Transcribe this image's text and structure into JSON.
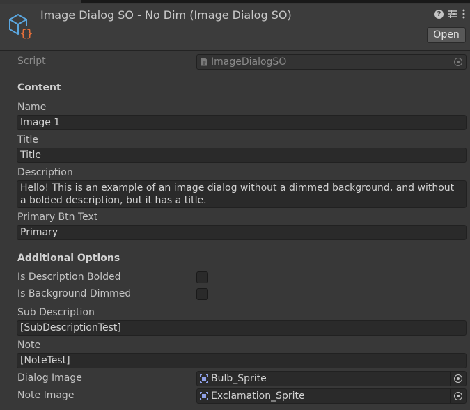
{
  "header": {
    "title": "Image Dialog SO - No Dim (Image Dialog SO)",
    "open_label": "Open",
    "icons": [
      "help-icon",
      "preset-sliders-icon",
      "more-vert-icon"
    ]
  },
  "script_row": {
    "label": "Script",
    "value": "ImageDialogSO"
  },
  "content": {
    "section_label": "Content",
    "name": {
      "label": "Name",
      "value": "Image 1"
    },
    "title": {
      "label": "Title",
      "value": "Title"
    },
    "description": {
      "label": "Description",
      "value": "Hello! This is an example of an image dialog without a dimmed background, and without a bolded description, but it has a title."
    },
    "primary_btn_text": {
      "label": "Primary Btn Text",
      "value": "Primary"
    }
  },
  "additional": {
    "section_label": "Additional Options",
    "is_description_bolded": {
      "label": "Is Description Bolded",
      "checked": false
    },
    "is_background_dimmed": {
      "label": "Is Background Dimmed",
      "checked": false
    },
    "sub_description": {
      "label": "Sub Description",
      "value": "[SubDescriptionTest]"
    },
    "note": {
      "label": "Note",
      "value": "[NoteTest]"
    },
    "dialog_image": {
      "label": "Dialog Image",
      "value": "Bulb_Sprite"
    },
    "note_image": {
      "label": "Note Image",
      "value": "Exclamation_Sprite"
    }
  },
  "colors": {
    "background": "#383838",
    "field": "#2a2a2a",
    "sprite_icon": "#8fa0e8",
    "asset_icon_blue": "#5ba7e0",
    "asset_icon_orange": "#e8703a"
  }
}
